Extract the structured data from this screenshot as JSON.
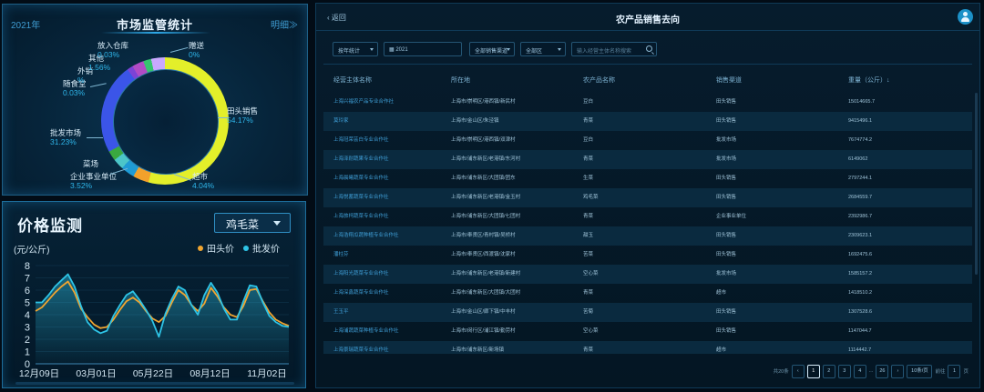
{
  "market": {
    "year": "2021年",
    "title": "市场监管统计",
    "detail_link": "明细≫",
    "slices": [
      {
        "name": "田头销售",
        "pct": "54.17%"
      },
      {
        "name": "超市",
        "pct": "4.04%"
      },
      {
        "name": "企业事业单位",
        "pct": "3.52%"
      },
      {
        "name": "菜场",
        "pct": ""
      },
      {
        "name": "批发市场",
        "pct": "31.23%"
      },
      {
        "name": "随食堂",
        "pct": "0.03%"
      },
      {
        "name": "外销",
        "pct": "%"
      },
      {
        "name": "其他",
        "pct": "1.56%"
      },
      {
        "name": "放入仓库",
        "pct": "0.03%"
      },
      {
        "name": "赠送",
        "pct": "0%"
      }
    ]
  },
  "price": {
    "title": "价格监测",
    "selected_product": "鸡毛菜",
    "unit": "(元/公斤)",
    "legend": [
      {
        "name": "田头价",
        "color": "#f0a530"
      },
      {
        "name": "批发价",
        "color": "#2ec4e6"
      }
    ]
  },
  "chart_data": {
    "type": "line",
    "ylabel": "(元/公斤)",
    "ylim": [
      0,
      8
    ],
    "yticks": [
      "0",
      "1",
      "2",
      "3",
      "4",
      "5",
      "6",
      "7",
      "8"
    ],
    "xticks": [
      "12月09日",
      "03月01日",
      "05月22日",
      "08月12日",
      "11月02日"
    ],
    "series": [
      {
        "name": "田头价",
        "values": [
          4.3,
          4.6,
          5.2,
          5.8,
          6.3,
          6.7,
          5.8,
          4.5,
          3.8,
          3.2,
          2.9,
          3.0,
          3.6,
          4.4,
          5.1,
          5.4,
          5.0,
          4.3,
          3.7,
          3.4,
          3.9,
          5.0,
          6.0,
          5.6,
          4.8,
          4.3,
          4.9,
          6.2,
          5.5,
          4.6,
          4.0,
          3.8,
          4.7,
          6.0,
          6.1,
          5.1,
          4.2,
          3.6,
          3.3,
          3.1
        ]
      },
      {
        "name": "批发价",
        "values": [
          5.0,
          5.0,
          5.6,
          6.3,
          6.8,
          7.3,
          6.3,
          4.7,
          3.4,
          2.8,
          2.5,
          2.7,
          3.9,
          4.8,
          5.6,
          5.9,
          5.2,
          4.4,
          3.5,
          2.2,
          4.1,
          5.3,
          6.3,
          6.0,
          4.8,
          4.0,
          5.6,
          6.6,
          5.8,
          4.5,
          3.6,
          3.6,
          5.1,
          6.4,
          6.3,
          5.0,
          3.9,
          3.4,
          3.1,
          3.0
        ]
      }
    ]
  },
  "sales": {
    "back_label": "返回",
    "title": "农产品销售去向",
    "filters": {
      "statistic": "按年统计",
      "year": "2021",
      "channel": "全部销售渠道",
      "district": "全部区",
      "search_placeholder": "输入经营主体名称搜索"
    },
    "columns": [
      "经营主体名称",
      "所在地",
      "农产品名称",
      "销售渠道",
      "重量（公斤）↓"
    ],
    "rows": [
      [
        "上海兴福农产品专业合作社",
        "上海市/崇明区/港西镇/新民村",
        "豆白",
        "田头销售",
        "15014665.7"
      ],
      [
        "莫玲家",
        "上海市/金山区/朱泾镇",
        "青菜",
        "田头销售",
        "9415496.1"
      ],
      [
        "上海冠荣芸白专业合作社",
        "上海市/崇明区/港西镇/双津村",
        "豆白",
        "批发市场",
        "7674774.2"
      ],
      [
        "上海泽耐蔬果专业合作社",
        "上海市/浦东新区/老港镇/东河村",
        "青菜",
        "批发市场",
        "6149062"
      ],
      [
        "上海晨曦蔬菜专业合作社",
        "上海市/浦东新区/大团镇/团东",
        "生菜",
        "田头销售",
        "2797244.1"
      ],
      [
        "上海悦蓄蔬菜专业合作社",
        "上海市/浦东新区/老港镇/金玉村",
        "鸡毛菜",
        "田头销售",
        "2684559.7"
      ],
      [
        "上海旅柯蔬菜专业合作社",
        "上海市/浦东新区/大团镇/七团村",
        "青菜",
        "企业事业单位",
        "2392986.7"
      ],
      [
        "上海浩翔瓜蔬种植专业合作社",
        "上海市/奉贤区/青村镇/吴桥村",
        "甜玉",
        "田头销售",
        "2309623.1"
      ],
      [
        "潘柱芬",
        "上海市/奉贤区/西渡镇/沈家村",
        "苦菜",
        "田头销售",
        "1692475.6"
      ],
      [
        "上海阳光蔬菜专业合作社",
        "上海市/浦东新区/老港镇/新建村",
        "空心菜",
        "批发市场",
        "1585157.2"
      ],
      [
        "上海深鑫蔬菜专业合作社",
        "上海市/浦东新区/大团镇/大团村",
        "青菜",
        "超市",
        "1418510.2"
      ],
      [
        "王玉平",
        "上海市/金山区/廊下镇/中丰村",
        "苦菊",
        "田头销售",
        "1307528.6"
      ],
      [
        "上海浦蔬蔬菜种植专业合作社",
        "上海市/闵行区/浦江镇/勤劳村",
        "空心菜",
        "田头销售",
        "1147044.7"
      ],
      [
        "上海景瑞蔬菜专业合作社",
        "上海市/浦东新区/新场镇",
        "青菜",
        "超市",
        "1114442.7"
      ]
    ],
    "pager": {
      "total": "共20条",
      "pages": [
        "1",
        "2",
        "3",
        "4",
        "...",
        "26"
      ],
      "per_page": "10条/页",
      "goto_label": "前往",
      "goto_value": "1",
      "page_suffix": "页"
    }
  }
}
